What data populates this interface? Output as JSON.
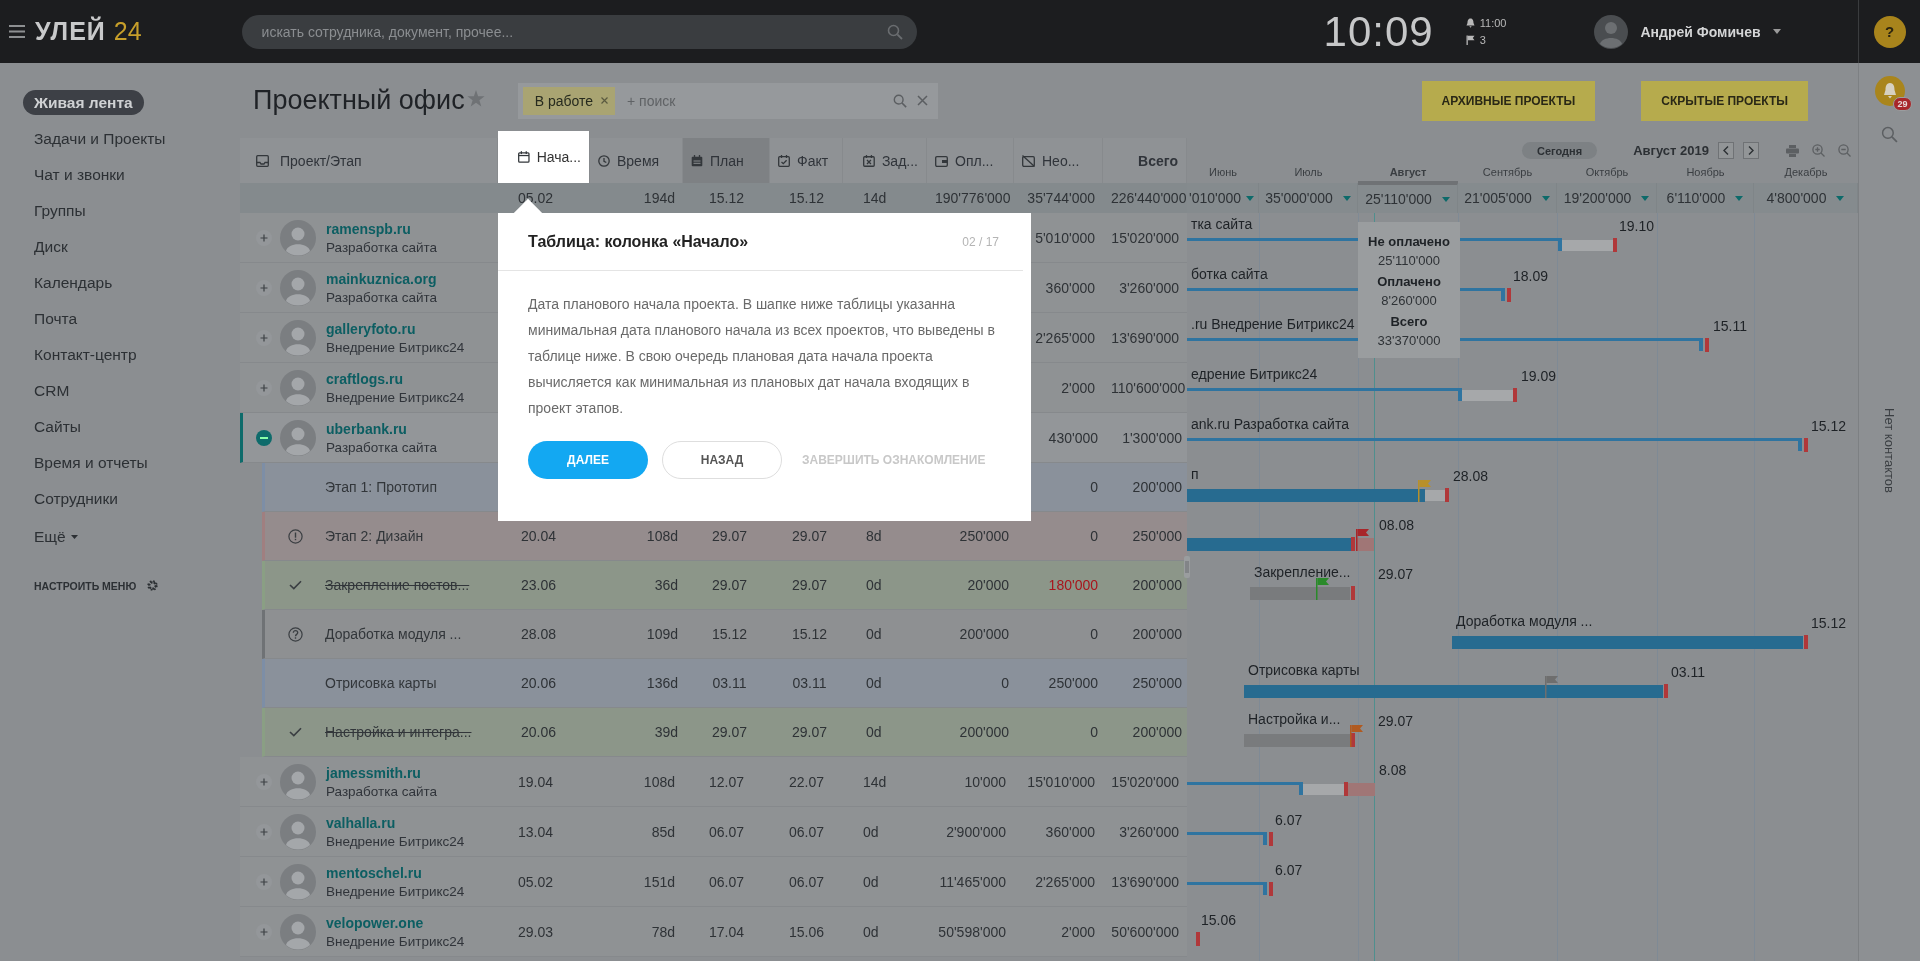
{
  "topbar": {
    "logo_text": "УЛЕЙ",
    "logo_number": "24",
    "search_placeholder": "искать сотрудника, документ, прочее...",
    "clock": "10:09",
    "next_event_time": "11:00",
    "flag_count": "3",
    "user_name": "Андрей Фомичев",
    "help": "?"
  },
  "sidebar": {
    "items": [
      {
        "label": "Живая лента",
        "selected": true
      },
      {
        "label": "Задачи и Проекты",
        "selected": false
      },
      {
        "label": "Чат и звонки",
        "selected": false
      },
      {
        "label": "Группы",
        "selected": false
      },
      {
        "label": "Диск",
        "selected": false
      },
      {
        "label": "Календарь",
        "selected": false
      },
      {
        "label": "Почта",
        "selected": false
      },
      {
        "label": "Контакт-центр",
        "selected": false
      },
      {
        "label": "CRM",
        "selected": false
      },
      {
        "label": "Сайты",
        "selected": false
      },
      {
        "label": "Время и отчеты",
        "selected": false
      },
      {
        "label": "Сотрудники",
        "selected": false
      }
    ],
    "more": "Ещё",
    "configure": "НАСТРОИТЬ МЕНЮ"
  },
  "page": {
    "title": "Проектный офис",
    "filter_tag": "В работе",
    "filter_placeholder": "+ поиск",
    "buttons": [
      "АРХИВНЫЕ ПРОЕКТЫ",
      "СКРЫТЫЕ ПРОЕКТЫ"
    ]
  },
  "table": {
    "name_header": "Проект/Этап",
    "columns": [
      {
        "label": "Нача...",
        "selected": false,
        "highlighted": true
      },
      {
        "label": "Время",
        "selected": false,
        "highlighted": false
      },
      {
        "label": "План",
        "selected": true,
        "highlighted": false
      },
      {
        "label": "Факт",
        "selected": false,
        "highlighted": false
      },
      {
        "label": "Зад...",
        "selected": false,
        "highlighted": false
      },
      {
        "label": "Опл...",
        "selected": false,
        "highlighted": false
      },
      {
        "label": "Нео...",
        "selected": false,
        "highlighted": false
      },
      {
        "label": "Всего",
        "selected": false,
        "highlighted": false
      }
    ],
    "totals": [
      "05.02",
      "194d",
      "15.12",
      "15.12",
      "14d",
      "190'776'000",
      "35'744'000",
      "226'440'000"
    ],
    "rows": [
      {
        "kind": "project",
        "name": "ramenspb.ru",
        "subtitle": "Разработка сайта",
        "expanded": false,
        "unpaid_alert": false,
        "cells": [
          null,
          null,
          null,
          null,
          null,
          null,
          "5'010'000",
          "15'020'000"
        ]
      },
      {
        "kind": "project",
        "name": "mainkuznica.org",
        "subtitle": "Разработка сайта",
        "expanded": false,
        "unpaid_alert": false,
        "cells": [
          null,
          null,
          null,
          null,
          null,
          null,
          "360'000",
          "3'260'000"
        ]
      },
      {
        "kind": "project",
        "name": "galleryfoto.ru",
        "subtitle": "Внедрение Битрикс24",
        "expanded": false,
        "unpaid_alert": false,
        "cells": [
          null,
          null,
          null,
          null,
          null,
          null,
          "2'265'000",
          "13'690'000"
        ]
      },
      {
        "kind": "project",
        "name": "craftlogs.ru",
        "subtitle": "Внедрение Битрикс24",
        "expanded": false,
        "unpaid_alert": false,
        "cells": [
          null,
          null,
          null,
          null,
          null,
          null,
          "2'000",
          "110'600'000"
        ]
      },
      {
        "kind": "project",
        "name": "uberbank.ru",
        "subtitle": "Разработка сайта",
        "expanded": true,
        "unpaid_alert": false,
        "cells": [
          null,
          null,
          null,
          null,
          null,
          null,
          "430'000",
          "1'300'000"
        ]
      },
      {
        "kind": "stage_plain",
        "title": "Этап 1: Прототип",
        "unpaid_alert": false,
        "cells": [
          null,
          null,
          null,
          null,
          null,
          null,
          "0",
          "200'000"
        ]
      },
      {
        "kind": "stage_alert",
        "title": "Этап 2: Дизайн",
        "unpaid_alert": false,
        "cells": [
          "20.04",
          "108d",
          "29.07",
          "29.07",
          "8d",
          "250'000",
          "0",
          "250'000"
        ]
      },
      {
        "kind": "stage_done",
        "title": "Закрепление постов...",
        "unpaid_alert": true,
        "cells": [
          "23.06",
          "36d",
          "29.07",
          "29.07",
          "0d",
          "20'000",
          "180'000",
          "200'000"
        ]
      },
      {
        "kind": "stage_unknown",
        "title": "Доработка модуля ...",
        "unpaid_alert": false,
        "cells": [
          "28.08",
          "109d",
          "15.12",
          "15.12",
          "0d",
          "200'000",
          "0",
          "200'000"
        ]
      },
      {
        "kind": "stage_plain",
        "title": "Отрисовка карты",
        "unpaid_alert": false,
        "cells": [
          "20.06",
          "136d",
          "03.11",
          "03.11",
          "0d",
          "0",
          "250'000",
          "250'000"
        ]
      },
      {
        "kind": "stage_done",
        "title": "Настройка и интегра...",
        "unpaid_alert": false,
        "cells": [
          "20.06",
          "39d",
          "29.07",
          "29.07",
          "0d",
          "200'000",
          "0",
          "200'000"
        ]
      },
      {
        "kind": "project",
        "name": "jamessmith.ru",
        "subtitle": "Разработка сайта",
        "expanded": false,
        "unpaid_alert": false,
        "cells": [
          "19.04",
          "108d",
          "12.07",
          "22.07",
          "14d",
          "10'000",
          "15'010'000",
          "15'020'000"
        ]
      },
      {
        "kind": "project",
        "name": "valhalla.ru",
        "subtitle": "Внедрение Битрикс24",
        "expanded": false,
        "unpaid_alert": false,
        "cells": [
          "13.04",
          "85d",
          "06.07",
          "06.07",
          "0d",
          "2'900'000",
          "360'000",
          "3'260'000"
        ]
      },
      {
        "kind": "project",
        "name": "mentoschel.ru",
        "subtitle": "Внедрение Битрикс24",
        "expanded": false,
        "unpaid_alert": false,
        "cells": [
          "05.02",
          "151d",
          "06.07",
          "06.07",
          "0d",
          "11'465'000",
          "2'265'000",
          "13'690'000"
        ]
      },
      {
        "kind": "project",
        "name": "velopower.one",
        "subtitle": "Внедрение Битрикс24",
        "expanded": false,
        "unpaid_alert": false,
        "cells": [
          "29.03",
          "78d",
          "17.04",
          "15.06",
          "0d",
          "50'598'000",
          "2'000",
          "50'600'000"
        ]
      }
    ]
  },
  "gantt": {
    "today_button": "Сегодня",
    "period": "Август 2019",
    "months": [
      {
        "label": "Июнь",
        "total": "'010'000",
        "selected": false
      },
      {
        "label": "Июль",
        "total": "35'000'000",
        "selected": false
      },
      {
        "label": "Август",
        "total": "25'110'000",
        "selected": true
      },
      {
        "label": "Сентябрь",
        "total": "21'005'000",
        "selected": false
      },
      {
        "label": "Октябрь",
        "total": "19'200'000",
        "selected": false
      },
      {
        "label": "Ноябрь",
        "total": "6'110'000",
        "selected": false
      },
      {
        "label": "Декабрь",
        "total": "4'800'000",
        "selected": false
      }
    ],
    "tooltip": [
      {
        "label": "Не оплачено",
        "value": "25'110'000"
      },
      {
        "label": "Оплачено",
        "value": "8'260'000"
      },
      {
        "label": "Всего",
        "value": "33'370'000"
      }
    ],
    "bars": [
      {
        "label": "тка сайта",
        "date": "19.10"
      },
      {
        "label": "ботка сайта",
        "date": "18.09"
      },
      {
        "label": ".ru Внедрение Битрикс24",
        "date": "15.11"
      },
      {
        "label": "едрение Битрикс24",
        "date": "19.09"
      },
      {
        "label": "ank.ru Разработка сайта",
        "date": "15.12"
      },
      {
        "label": "п",
        "date": "28.08"
      },
      {
        "date": "08.08"
      },
      {
        "label": "Закрепление...",
        "date": "29.07"
      },
      {
        "label": "Доработка модуля ...",
        "date": "15.12"
      },
      {
        "label": "Отрисовка карты",
        "date": "03.11"
      },
      {
        "label": "Настройка и...",
        "date": "29.07"
      },
      {
        "date": "8.08"
      },
      {
        "date": "6.07"
      },
      {
        "date": "6.07"
      },
      {
        "date": "15.06"
      }
    ]
  },
  "right_panel": {
    "notification_count": "29",
    "contacts_text": "Нет контактов"
  },
  "tour": {
    "title": "Таблица: колонка «Начало»",
    "counter": "02 / 17",
    "text": "Дата планового начала проекта. В шапке ниже таблицы указанна минимальная дата планового начала из всех проектов, что выведены в таблице ниже. В свою очередь плановая дата начала проекта вычисляется как минимальная из плановых дат начала входящих в проект этапов.",
    "next": "ДАЛЕЕ",
    "back": "НАЗАД",
    "finish": "ЗАВЕРШИТЬ ОЗНАКОМЛЕНИЕ"
  }
}
